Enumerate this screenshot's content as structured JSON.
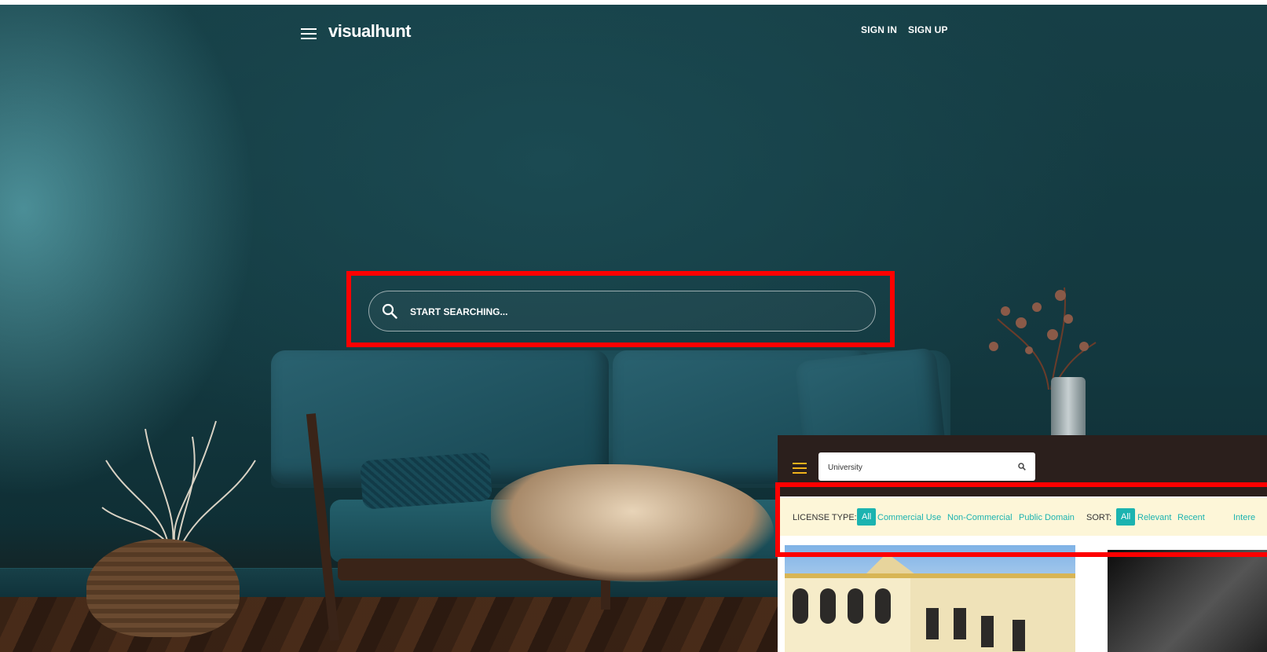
{
  "header": {
    "logo_text": "visualhunt",
    "sign_in": "SIGN IN",
    "sign_up": "SIGN UP"
  },
  "search": {
    "placeholder": "START SEARCHING..."
  },
  "results_view": {
    "search_value": "University",
    "license_type_label": "LICENSE TYPE:",
    "license_options": [
      "All",
      "Commercial Use",
      "Non-Commercial",
      "Public Domain"
    ],
    "sort_label": "SORT:",
    "sort_options": [
      "All",
      "Relevant",
      "Recent",
      "Intere"
    ],
    "selected_license": "All",
    "selected_sort": "All"
  },
  "colors": {
    "highlight": "#ff0000",
    "accent_teal": "#1bb3b0",
    "menu_yellow": "#f1b21b",
    "filter_bg": "#fdf6d8",
    "inset_header": "#2b1f1c"
  },
  "icons": [
    "menu-icon",
    "search-icon"
  ]
}
